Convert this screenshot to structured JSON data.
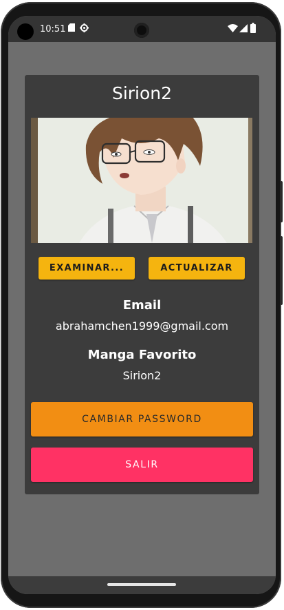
{
  "status_bar": {
    "time": "10:51",
    "icons": [
      "sd-card-icon",
      "settings-icon",
      "wifi-icon",
      "signal-icon",
      "battery-icon"
    ]
  },
  "profile": {
    "title": "Sirion2",
    "image": "anime-avatar-image",
    "email_label": "Email",
    "email_value": "abrahamchen1999@gmail.com",
    "manga_label": "Manga Favorito",
    "manga_value": "Sirion2"
  },
  "buttons": {
    "browse": "EXAMINAR...",
    "update": "ACTUALIZAR",
    "change_password": "CAMBIAR PASSWORD",
    "logout": "SALIR"
  },
  "colors": {
    "accent_yellow": "#f5b40f",
    "accent_orange": "#f28e13",
    "accent_pink": "#ff3264",
    "card_bg": "#3c3c3c",
    "screen_bg": "#6e6e6e"
  }
}
